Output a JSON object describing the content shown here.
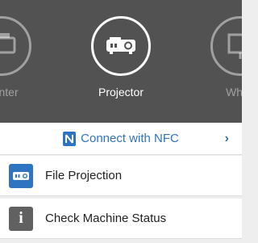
{
  "colors": {
    "carousel_bg": "#525252",
    "accent_blue": "#2f74c0",
    "status_icon_bg": "#616161"
  },
  "devices": [
    {
      "label": "Printer",
      "icon": "printer-icon",
      "selected": false
    },
    {
      "label": "Projector",
      "icon": "projector-icon",
      "selected": true
    },
    {
      "label": "White",
      "icon": "whiteboard-icon",
      "selected": false
    }
  ],
  "nfc": {
    "label": "Connect with NFC",
    "icon": "nfc-icon",
    "chevron": "›"
  },
  "menu": [
    {
      "label": "File Projection",
      "icon": "file-projection-icon"
    },
    {
      "label": "Check Machine Status",
      "icon": "info-icon",
      "glyph": "i"
    }
  ]
}
